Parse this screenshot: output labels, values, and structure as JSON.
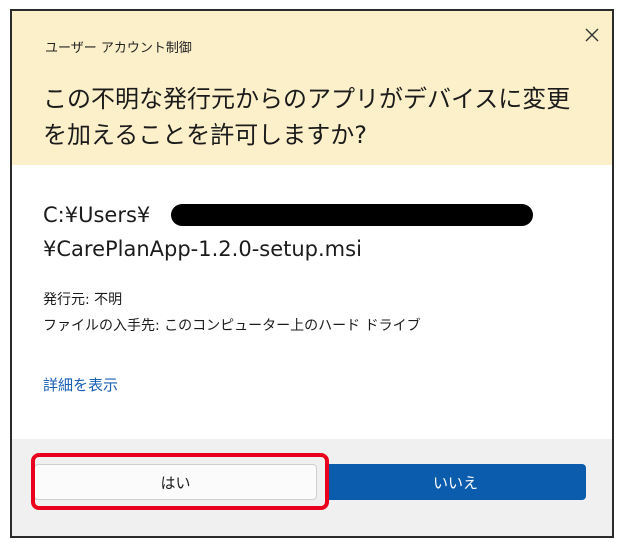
{
  "dialog": {
    "window_title": "ユーザー アカウント制御",
    "question": "この不明な発行元からのアプリがデバイスに変更を加えることを許可しますか?",
    "close_icon": "close-icon",
    "file_path": {
      "line1_prefix": "C:¥Users¥",
      "line2": "¥CarePlanApp-1.2.0-setup.msi"
    },
    "publisher_line": "発行元: 不明",
    "origin_line": "ファイルの入手先: このコンピューター上のハード ドライブ",
    "details_link": "詳細を表示",
    "yes_button": "はい",
    "no_button": "いいえ"
  },
  "colors": {
    "header_bg": "#fcf0cb",
    "link": "#1a5fb4",
    "primary_button": "#0b5cad",
    "highlight": "#e8001c",
    "redaction": "#000000"
  }
}
